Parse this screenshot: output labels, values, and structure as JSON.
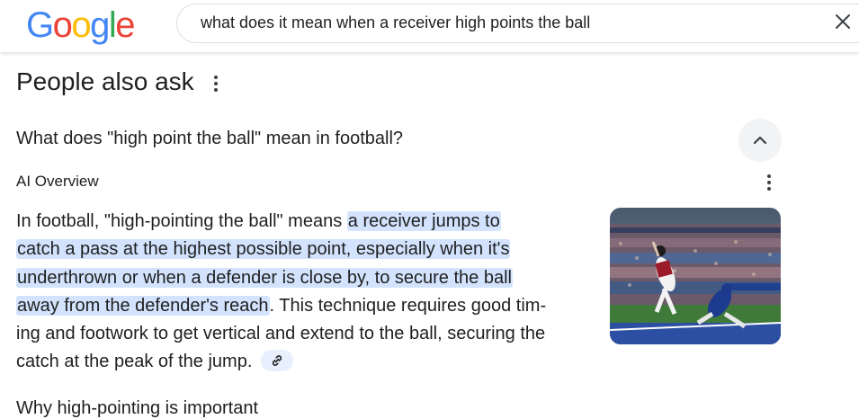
{
  "header": {
    "logo_letters": [
      {
        "ch": "G",
        "color": "#4285F4"
      },
      {
        "ch": "o",
        "color": "#EA4335"
      },
      {
        "ch": "o",
        "color": "#FBBC05"
      },
      {
        "ch": "g",
        "color": "#4285F4"
      },
      {
        "ch": "l",
        "color": "#34A853"
      },
      {
        "ch": "e",
        "color": "#EA4335"
      }
    ],
    "search_query": "what does it mean when a receiver high points the ball",
    "clear_icon": "close-icon"
  },
  "paa": {
    "title": "People also ask",
    "menu_icon": "more-vert-icon",
    "question": "What does \"high point the ball\" mean in football?",
    "collapse_icon": "chevron-up-icon",
    "ai_overview_label": "AI Overview",
    "ai_menu_icon": "more-vert-icon",
    "answer_lines": [
      {
        "plain": "In football, \"high-pointing the ball\" means ",
        "highlight": "a receiver jumps to",
        "after": ""
      },
      {
        "plain": "",
        "highlight": "catch a pass at the highest possible point, especially when it's",
        "after": ""
      },
      {
        "plain": "",
        "highlight": "underthrown or when a defender is close by, to secure the ball",
        "after": ""
      },
      {
        "plain": "",
        "highlight": "away from the defender's reach",
        "after": ". This technique requires good tim-"
      },
      {
        "plain": "ing and footwork to get vertical and extend to the ball, securing the",
        "highlight": "",
        "after": ""
      },
      {
        "plain": "catch at the peak of the jump.",
        "highlight": "",
        "after": ""
      }
    ],
    "link_icon": "link-icon",
    "image_icon": "football-catch-photo",
    "next_heading": "Why high-pointing is important"
  },
  "colors": {
    "highlight": "#d3e3fd",
    "text": "#1f1f1f",
    "chip": "#e8f0fe"
  }
}
